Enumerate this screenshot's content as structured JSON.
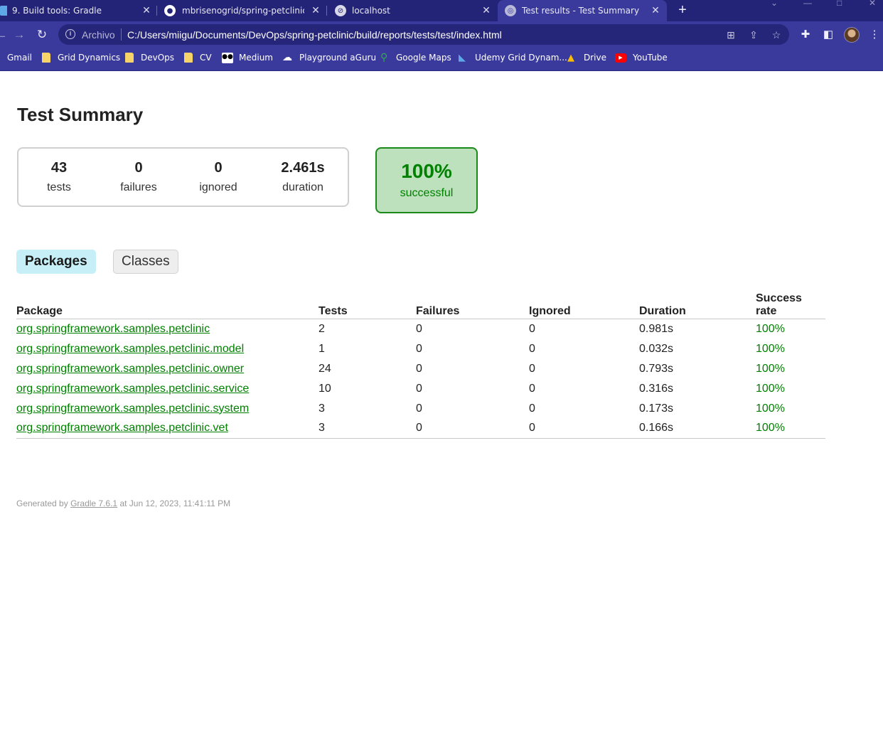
{
  "browser": {
    "tabs": [
      {
        "title": "9. Build tools: Gradle",
        "active": false
      },
      {
        "title": "mbrisenogrid/spring-petclinic: A",
        "active": false
      },
      {
        "title": "localhost",
        "active": false
      },
      {
        "title": "Test results - Test Summary",
        "active": true
      }
    ],
    "scheme_label": "Archivo",
    "url": "C:/Users/miigu/Documents/DevOps/spring-petclinic/build/reports/tests/test/index.html",
    "bookmarks": [
      "Gmail",
      "Grid Dynamics",
      "DevOps",
      "CV",
      "Medium",
      "Playground aGuru",
      "Google Maps",
      "Udemy Grid Dynam...",
      "Drive",
      "YouTube"
    ]
  },
  "report": {
    "title": "Test Summary",
    "counters": {
      "tests": {
        "value": "43",
        "label": "tests"
      },
      "failures": {
        "value": "0",
        "label": "failures"
      },
      "ignored": {
        "value": "0",
        "label": "ignored"
      },
      "duration": {
        "value": "2.461s",
        "label": "duration"
      }
    },
    "success": {
      "percent": "100%",
      "label": "successful"
    },
    "tabs": {
      "packages": "Packages",
      "classes": "Classes"
    },
    "table": {
      "headers": [
        "Package",
        "Tests",
        "Failures",
        "Ignored",
        "Duration",
        "Success rate"
      ],
      "rows": [
        {
          "package": "org.springframework.samples.petclinic",
          "tests": "2",
          "failures": "0",
          "ignored": "0",
          "duration": "0.981s",
          "rate": "100%"
        },
        {
          "package": "org.springframework.samples.petclinic.model",
          "tests": "1",
          "failures": "0",
          "ignored": "0",
          "duration": "0.032s",
          "rate": "100%"
        },
        {
          "package": "org.springframework.samples.petclinic.owner",
          "tests": "24",
          "failures": "0",
          "ignored": "0",
          "duration": "0.793s",
          "rate": "100%"
        },
        {
          "package": "org.springframework.samples.petclinic.service",
          "tests": "10",
          "failures": "0",
          "ignored": "0",
          "duration": "0.316s",
          "rate": "100%"
        },
        {
          "package": "org.springframework.samples.petclinic.system",
          "tests": "3",
          "failures": "0",
          "ignored": "0",
          "duration": "0.173s",
          "rate": "100%"
        },
        {
          "package": "org.springframework.samples.petclinic.vet",
          "tests": "3",
          "failures": "0",
          "ignored": "0",
          "duration": "0.166s",
          "rate": "100%"
        }
      ]
    },
    "footer": {
      "prefix": "Generated by",
      "link": "Gradle 7.6.1",
      "suffix": "at Jun 12, 2023, 11:41:11 PM"
    }
  },
  "colors": {
    "success_green": "#008000",
    "chrome_bg": "#3a3a9c",
    "tabbar_bg": "#232377"
  }
}
